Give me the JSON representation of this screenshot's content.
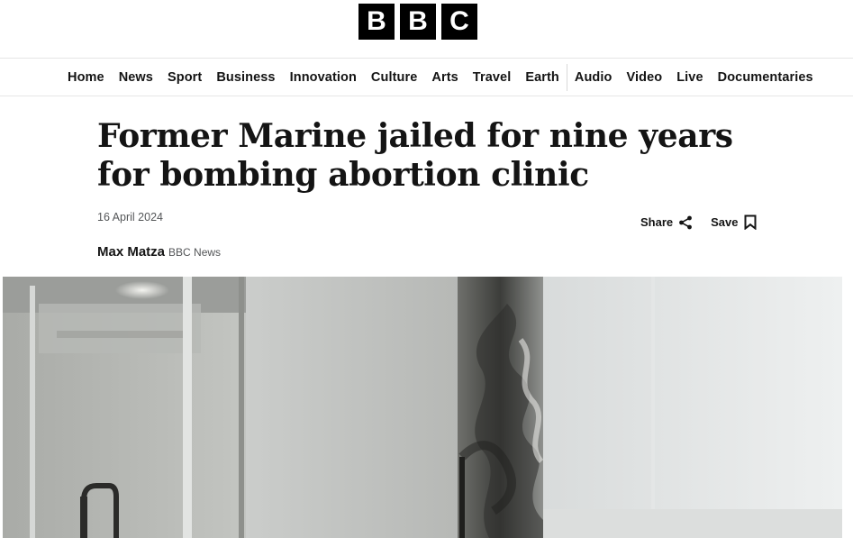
{
  "logo": {
    "letters": [
      "B",
      "B",
      "C"
    ]
  },
  "nav": {
    "items": [
      "Home",
      "News",
      "Sport",
      "Business",
      "Innovation",
      "Culture",
      "Arts",
      "Travel",
      "Earth",
      "Audio",
      "Video",
      "Live",
      "Documentaries"
    ]
  },
  "article": {
    "headline": "Former Marine jailed for nine years for bombing abortion clinic",
    "date": "16 April 2024",
    "share_label": "Share",
    "save_label": "Save",
    "author": "Max Matza",
    "organization": "BBC News"
  },
  "icons": {
    "share": "share-icon",
    "save": "bookmark-icon"
  },
  "colors": {
    "brand": "#000000",
    "text": "#141414",
    "muted": "#545658"
  }
}
